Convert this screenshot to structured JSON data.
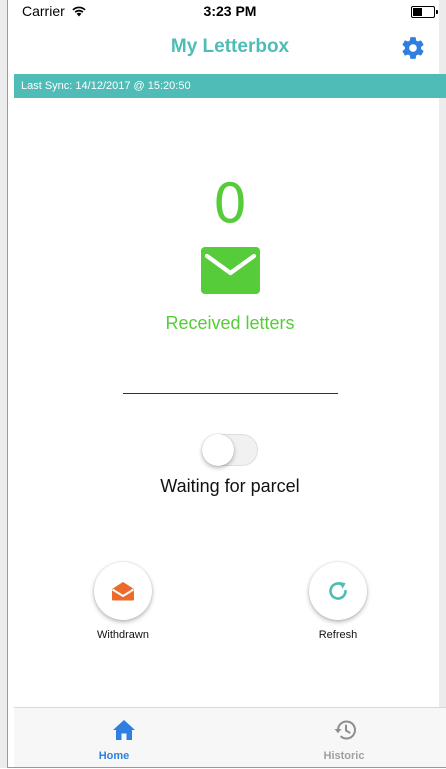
{
  "status_bar": {
    "carrier": "Carrier",
    "time": "3:23 PM"
  },
  "header": {
    "title": "My Letterbox",
    "settings_icon": "gear-icon"
  },
  "sync": {
    "text": "Last Sync: 14/12/2017 @ 15:20:50"
  },
  "letters": {
    "count": "0",
    "label": "Received letters",
    "icon": "envelope-icon"
  },
  "parcel": {
    "toggle_on": false,
    "label": "Waiting for parcel"
  },
  "actions": {
    "withdrawn_label": "Withdrawn",
    "withdrawn_icon": "open-envelope-icon",
    "refresh_label": "Refresh",
    "refresh_icon": "refresh-icon"
  },
  "tabs": [
    {
      "label": "Home",
      "icon": "home-icon",
      "active": true
    },
    {
      "label": "Historic",
      "icon": "history-icon",
      "active": false
    }
  ],
  "colors": {
    "accent": "#4fbdb7",
    "sync_bar": "#50bcb7",
    "letters_green": "#57cc3a",
    "settings_blue": "#2f7fe0",
    "withdrawn_orange": "#ea6b2c",
    "refresh_teal": "#4fbdb7",
    "tab_active": "#2f7fe0",
    "tab_inactive": "#a0a0a0"
  }
}
